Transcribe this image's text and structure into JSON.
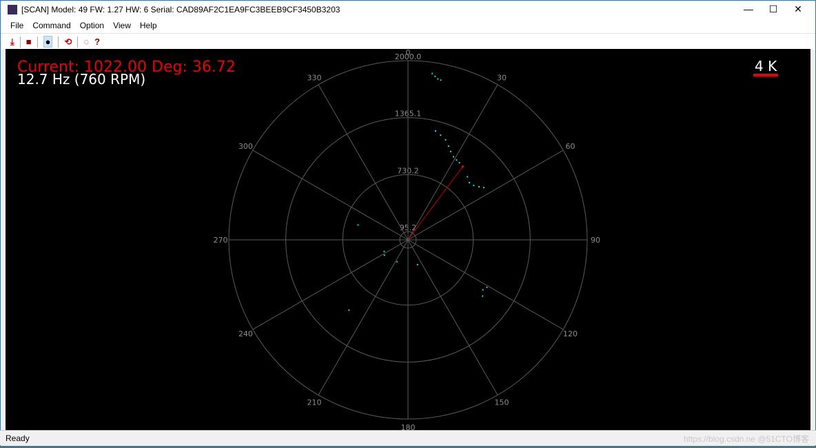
{
  "window": {
    "title": "[SCAN] Model: 49 FW: 1.27 HW: 6 Serial: CAD89AF2C1EA9FC3BEEB9CF3450B3203",
    "minimize": "—",
    "maximize": "☐",
    "close": "✕"
  },
  "menu": [
    "File",
    "Command",
    "Option",
    "View",
    "Help"
  ],
  "toolbar": [
    {
      "icon": "download-arrow-icon",
      "glyph": "⤓",
      "color": "#e00000"
    },
    {
      "icon": "stop-icon",
      "glyph": "■",
      "color": "#8b0000"
    },
    {
      "icon": "radar-icon",
      "glyph": "●",
      "color": "#000000"
    },
    {
      "icon": "refresh-icon",
      "glyph": "⟲",
      "color": "#e00000"
    },
    {
      "icon": "gauge-icon",
      "glyph": "◌",
      "color": "#e00000"
    },
    {
      "icon": "help-icon",
      "glyph": "?",
      "color": "#8b0000"
    }
  ],
  "overlay": {
    "current": "Current: 1022.00 Deg: 36.72",
    "frequency": "12.7 Hz (760 RPM)",
    "scale": "4 K"
  },
  "status": "Ready",
  "watermark": "https://blog.csdn.ne @51CTO博客",
  "chart_data": {
    "type": "scatter",
    "coordinate": "polar",
    "rings": [
      "95.2",
      "730.2",
      "1365.1",
      "2000.0"
    ],
    "ring_values": [
      95.2,
      730.2,
      1365.1,
      2000.0
    ],
    "angle_labels": [
      "0",
      "30",
      "60",
      "90",
      "120",
      "150",
      "180",
      "210",
      "240",
      "270",
      "300",
      "330"
    ],
    "current": {
      "angle": 36.72,
      "distance": 1022.0
    },
    "colors": {
      "points": "#00e5e5",
      "current": "#c00000",
      "grid": "#5a5a5a"
    },
    "points": [
      [
        8.3,
        1876
      ],
      [
        9.4,
        1850
      ],
      [
        10.5,
        1827
      ],
      [
        11.6,
        1820
      ],
      [
        14.2,
        1255
      ],
      [
        17.3,
        1225
      ],
      [
        20.6,
        1194
      ],
      [
        23.4,
        1142
      ],
      [
        25.8,
        1097
      ],
      [
        28.7,
        1059
      ],
      [
        31.3,
        1044
      ],
      [
        33.7,
        1036
      ],
      [
        43.3,
        969
      ],
      [
        47,
        938
      ],
      [
        50.4,
        954
      ],
      [
        53.2,
        991
      ],
      [
        55.4,
        1029
      ],
      [
        121,
        1029
      ],
      [
        123.7,
        1006
      ],
      [
        127,
        1044
      ],
      [
        286.6,
        584
      ],
      [
        244,
        298
      ],
      [
        237,
        317
      ],
      [
        206.6,
        276
      ],
      [
        159,
        299
      ],
      [
        220,
        1027
      ]
    ]
  }
}
